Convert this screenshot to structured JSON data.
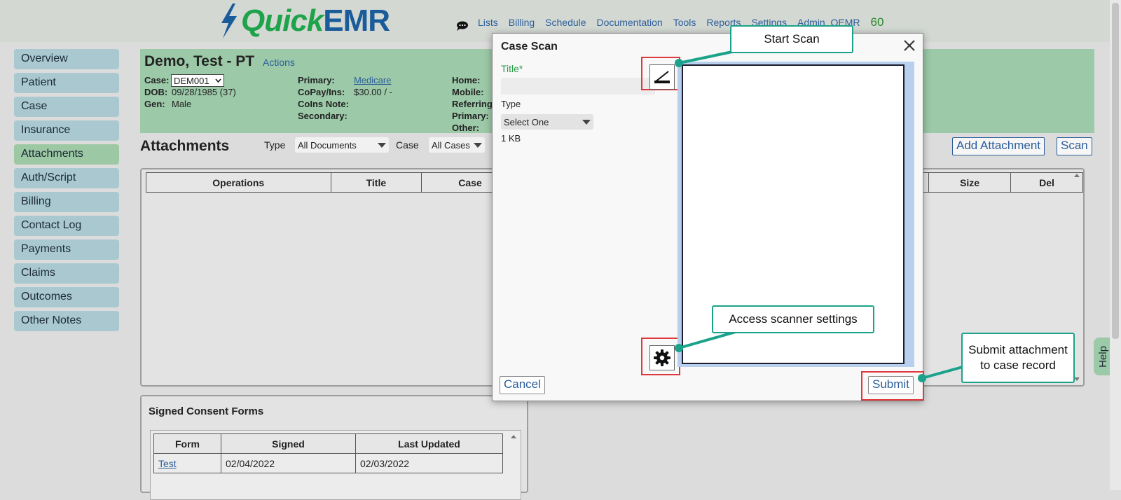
{
  "brand": {
    "quick": "Quick",
    "emr": "EMR",
    "bolt_color": "#1a5c9a",
    "quick_color": "#1fa34a",
    "emr_color": "#1a5c9a"
  },
  "topnav": {
    "items": [
      "Lists",
      "Billing",
      "Schedule",
      "Documentation",
      "Tools",
      "Reports",
      "Settings",
      "Admin_QEMR"
    ],
    "count": "60",
    "chat_icon": "chat-bubble-icon"
  },
  "sidebar": {
    "items": [
      "Overview",
      "Patient",
      "Case",
      "Insurance",
      "Attachments",
      "Auth/Script",
      "Billing",
      "Contact Log",
      "Payments",
      "Claims",
      "Outcomes",
      "Other Notes"
    ],
    "active": "Attachments"
  },
  "patient": {
    "name": "Demo, Test - PT",
    "actions": "Actions",
    "case_label": "Case:",
    "case_value": "DEM001",
    "dob_label": "DOB:",
    "dob_value": "09/28/1985 (37)",
    "gen_label": "Gen:",
    "gen_value": "Male",
    "primary_label": "Primary:",
    "primary_value": "Medicare",
    "copay_label": "CoPay/Ins:",
    "copay_value": "$30.00 / -",
    "coins_label": "CoIns Note:",
    "secondary_label": "Secondary:",
    "home_label": "Home:",
    "mobile_label": "Mobile:",
    "referring_label": "Referring",
    "primary2_label": "Primary:",
    "other_label": "Other:"
  },
  "attachments": {
    "title": "Attachments",
    "type_label": "Type",
    "type_value": "All Documents",
    "case_label": "Case",
    "case_value": "All Cases",
    "add_button": "Add Attachment",
    "scan_button": "Scan",
    "columns": [
      "Operations",
      "Title",
      "Case",
      "Size",
      "Del"
    ]
  },
  "consent": {
    "title": "Signed Consent Forms",
    "columns": [
      "Form",
      "Signed",
      "Last Updated"
    ],
    "rows": [
      {
        "form": "Test",
        "signed": "02/04/2022",
        "updated": "02/03/2022"
      }
    ]
  },
  "help": "Help",
  "modal": {
    "title": "Case Scan",
    "title_label": "Title*",
    "type_label": "Type",
    "type_value": "Select One",
    "size": "1 KB",
    "cancel": "Cancel",
    "submit": "Submit",
    "scan_icon": "scanner-icon",
    "settings_icon": "gear-icon"
  },
  "callouts": {
    "start_scan": "Start Scan",
    "settings": "Access scanner settings",
    "submit": "Submit attachment to case record",
    "accent": "#1aa38a",
    "highlight": "#e0393d"
  }
}
